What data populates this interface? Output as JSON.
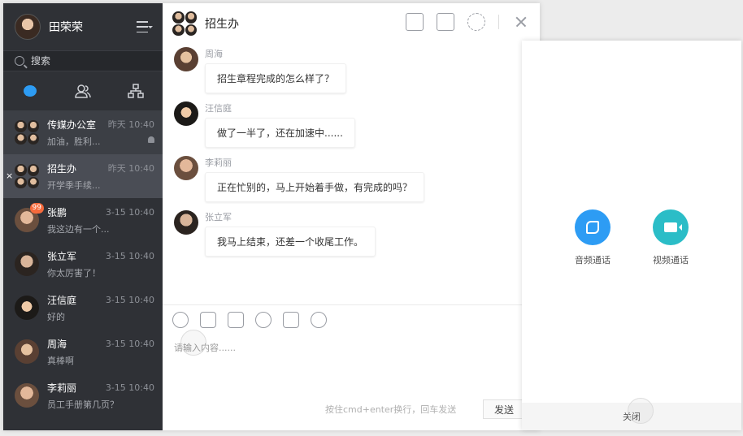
{
  "user": {
    "name": "田荣荣"
  },
  "search": {
    "placeholder": "搜索"
  },
  "conversations": [
    {
      "name": "传媒办公室",
      "time": "昨天 10:40",
      "msg": "加油，胜利..."
    },
    {
      "name": "招生办",
      "time": "昨天 10:40",
      "msg": "开学季手续..."
    },
    {
      "name": "张鹏",
      "time": "3-15 10:40",
      "msg": "我这边有一个...",
      "badge": "99"
    },
    {
      "name": "张立军",
      "time": "3-15 10:40",
      "msg": "你太厉害了！"
    },
    {
      "name": "汪信庭",
      "time": "3-15 10:40",
      "msg": "好的"
    },
    {
      "name": "周海",
      "time": "3-15 10:40",
      "msg": "真棒啊"
    },
    {
      "name": "李莉丽",
      "time": "3-15 10:40",
      "msg": "员工手册第几页？"
    }
  ],
  "chat": {
    "title": "招生办",
    "messages": [
      {
        "sender": "周海",
        "text": "招生章程完成的怎么样了？"
      },
      {
        "sender": "汪信庭",
        "text": "做了一半了，还在加速中......"
      },
      {
        "sender": "李莉丽",
        "text": "正在忙别的，马上开始着手做，有完成的吗？"
      },
      {
        "sender": "张立军",
        "text": "我马上结束，还差一个收尾工作。"
      }
    ],
    "input_placeholder": "请输入内容......",
    "hint": "按住cmd+enter换行，回车发送",
    "send_label": "发送"
  },
  "panel": {
    "audio_label": "音频通话",
    "video_label": "视频通话",
    "close_label": "关闭",
    "audio_color": "#2d9cf4",
    "video_color": "#2bbdc7"
  }
}
